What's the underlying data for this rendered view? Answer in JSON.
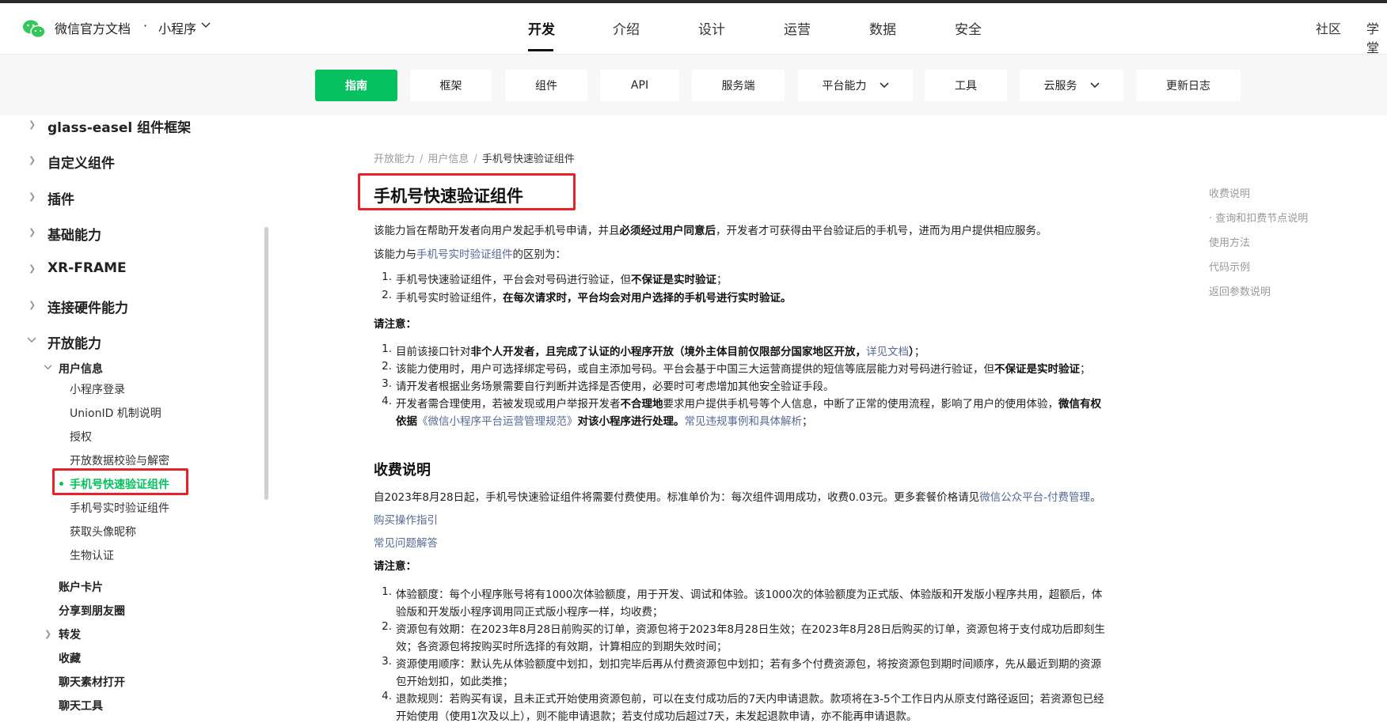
{
  "header": {
    "site_title": "微信官方文档",
    "dot": "·",
    "product": "小程序",
    "nav": [
      "开发",
      "介绍",
      "设计",
      "运营",
      "数据",
      "安全"
    ],
    "right_links": [
      "社区",
      "学堂"
    ]
  },
  "subnav": {
    "items": [
      "指南",
      "框架",
      "组件",
      "API",
      "服务端",
      "平台能力",
      "工具",
      "云服务",
      "更新日志"
    ],
    "active": "指南"
  },
  "sidebar": {
    "top_items": [
      "glass-easel 组件框架",
      "自定义组件",
      "插件",
      "基础能力",
      "XR-FRAME",
      "连接硬件能力",
      "开放能力"
    ],
    "group": "用户信息",
    "group_items": [
      "小程序登录",
      "UnionID 机制说明",
      "授权",
      "开放数据校验与解密",
      "手机号快速验证组件",
      "手机号实时验证组件",
      "获取头像昵称",
      "生物认证"
    ],
    "more_items": [
      "账户卡片",
      "分享到朋友圈",
      "转发",
      "收藏",
      "聊天素材打开",
      "聊天工具"
    ]
  },
  "breadcrumb": [
    "开放能力",
    "用户信息",
    "手机号快速验证组件"
  ],
  "page": {
    "title": "手机号快速验证组件",
    "intro_a": "该能力旨在帮助开发者向用户发起手机号申请，并且",
    "intro_b": "必须经过用户同意后",
    "intro_c": "，开发者才可获得由平台验证后的手机号，进而为用户提供相应服务。",
    "diff_a": "该能力与",
    "diff_link": "手机号实时验证组件",
    "diff_c": "的区别为：",
    "diff_1a": "手机号快速验证组件，平台会对号码进行验证，但",
    "diff_1b": "不保证是实时验证",
    "diff_1c": "；",
    "diff_2a": "手机号实时验证组件，",
    "diff_2b": "在每次请求时，平台均会对用户选择的手机号进行实时验证。",
    "notice": "请注意：",
    "n1a": "目前该接口针对",
    "n1b": "非个人开发者，且完成了认证的小程序开放（境外主体目前仅限部分国家地区开放，",
    "n1link": "详见文档",
    "n1c": "）",
    "n1d": "；",
    "n2a": "该能力使用时，用户可选择绑定号码，或自主添加号码。平台会基于中国三大运营商提供的短信等底层能力对号码进行验证，但",
    "n2b": "不保证是实时验证",
    "n2c": "；",
    "n3": "请开发者根据业务场景需要自行判断并选择是否使用，必要时可考虑增加其他安全验证手段。",
    "n4a": "开发者需合理使用，若被发现或用户举报开发者",
    "n4b": "不合理地",
    "n4c": "要求用户提供手机号等个人信息，中断了正常的使用流程，影响了用户的使用体验，",
    "n4d": "微信有权",
    "n4e": "依据",
    "n4link": "《微信小程序平台运营管理规范》",
    "n4f": "对该小程序进行处理。",
    "n4link2": "常见违规事例和具体解析",
    "n4g": "；",
    "fee_title": "收费说明",
    "fee_a": "自2023年8月28日起，手机号快速验证组件将需要付费使用。标准单价为：每次组件调用成功，收费0.03元。更多套餐价格请见",
    "fee_link": "微信公众平台-付费管理",
    "fee_c": "。",
    "buy_link": "购买操作指引",
    "faq_link": "常见问题解答",
    "notice2": "请注意：",
    "f1a": "体验额度：每个小程序账号将有1000次体验额度，用于开发、调试和体验。该1000次的体验额度为正式版、体验版和开发版小程序共用，超额后，体",
    "f1b": "验版和开发版小程序调用同正式版小程序一样，均收费；",
    "f2a": "资源包有效期：在2023年8月28日前购买的订单，资源包将于2023年8月28日生效；在2023年8月28日后购买的订单，资源包将于支付成功后即刻生",
    "f2b": "效；各资源包将按购买时所选择的有效期，计算相应的到期失效时间；",
    "f3a": "资源使用顺序：默认先从体验额度中划扣，划扣完毕后再从付费资源包中划扣；若有多个付费资源包，将按资源包到期时间顺序，先从最近到期的资源",
    "f3b": "包开始划扣，如此类推；",
    "f4a": "退款规则：若购买有误，且未正式开始使用资源包前，可以在支付成功后的7天内申请退款。款项将在3-5个工作日内从原支付路径返回；若资源包已经",
    "f4b": "开始使用（使用1次及以上），则不能申请退款；若支付成功后超过7天，未发起退款申请，亦不能再申请退款。"
  },
  "toc": [
    "收费说明",
    "· 查询和扣费节点说明",
    "使用方法",
    "代码示例",
    "返回参数说明"
  ],
  "colors": {
    "accent": "#07c160",
    "link": "#576b95",
    "highlight_box": "#e5212b"
  }
}
